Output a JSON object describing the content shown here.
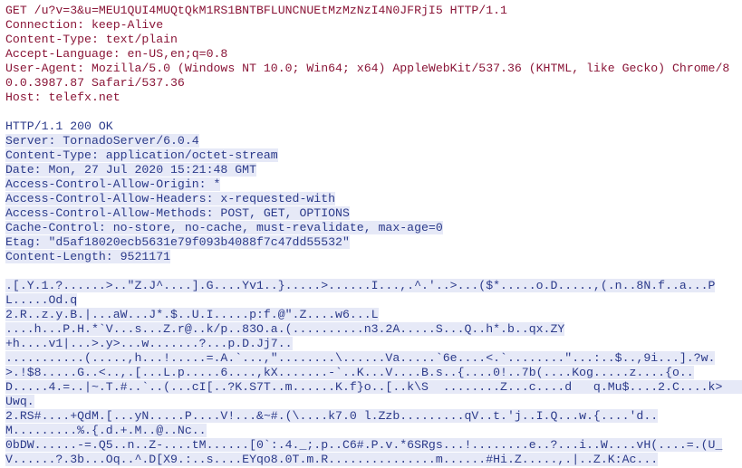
{
  "request": {
    "line": "GET /u?v=3&u=MEU1QUI4MUQtQkM1RS1BNTBFLUNCNUEtMzMzNzI4N0JFRjI5 HTTP/1.1",
    "headers": [
      "Connection: keep-Alive",
      "Content-Type: text/plain",
      "Accept-Language: en-US,en;q=0.8",
      "User-Agent: Mozilla/5.0 (Windows NT 10.0; Win64; x64) AppleWebKit/537.36 (KHTML, like Gecko) Chrome/80.0.3987.87 Safari/537.36",
      "Host: telefx.net"
    ]
  },
  "response": {
    "status": "HTTP/1.1 200 OK",
    "headers": [
      "Server: TornadoServer/6.0.4",
      "Content-Type: application/octet-stream",
      "Date: Mon, 27 Jul 2020 15:21:48 GMT",
      "Access-Control-Allow-Origin: *",
      "Access-Control-Allow-Headers: x-requested-with",
      "Access-Control-Allow-Methods: POST, GET, OPTIONS",
      "Cache-Control: no-store, no-cache, must-revalidate, max-age=0",
      "Etag: \"d5af18020ecb5631e79f093b4088f7c47dd55532\"",
      "Content-Length: 9521171"
    ],
    "body": [
      ".[.Y.1.?......>..\"Z.J^....].G....Yv1..}.....>......I...,.^.'..>...($*.....o.D.....,(.n..8N.f..a...PL.....Od.q",
      "2.R..z.y.B.|...aW...J*.$..U.I.....p:f.@\".Z....w6...L",
      "....h...P.H.*`V...s...Z.r@..k/p..83O.a.(..........n3.2A.....S...Q..h*.b..qx.ZY",
      "+h....v1|...>.y>...w.......?...p.D.Jj7..",
      "...........(.....,h...!.....=.A.`...,\"........\\......Va.....`6e....<.`........\"...:..$..,9i...].?w.>.!$8.....G..<..,.[...L.p.....6....,kX.......-`..K...V....B.s..{....0!..7b(....Kog.....z....{o..D.....4.=..|~.T.#..`..(...cI[..?K.S7T..m......K.f}o..[..k\\S  ........Z...c....d   q.Mu$....2.C....k>          Uwq.",
      "2.RS#....+QdM.[...yN.....P....V!...&~#.(\\....k7.0 l.Zzb.........qV..t.'j..I.Q...w.{....'d..M.........%.{.d.+.M..@..Nc..",
      "0bDW......-=.Q5..n..Z-....tM......[0`:.4._;.p..C6#.P.v.*6SRgs...!........e..?...i..W....vH(....=.(U_V......?.3b...Oq..^.D[X9.:..s....EYqo8.0T.m.R...............m......#Hi.Z.....,.|..Z.K:Ac..."
    ]
  }
}
